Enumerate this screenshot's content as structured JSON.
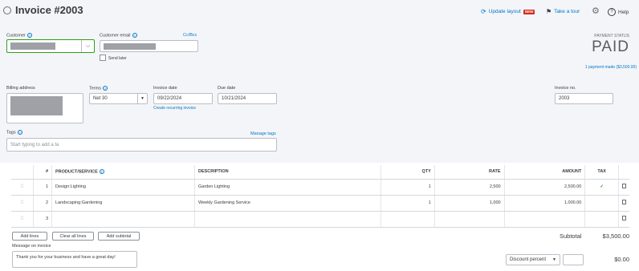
{
  "header": {
    "title": "Invoice #2003",
    "update_layout": "Update layout",
    "new_badge": "NEW",
    "take_tour": "Take a tour",
    "help": "Help"
  },
  "customer": {
    "label": "Customer",
    "email_label": "Customer email",
    "cc_bcc": "Cc/Bcc",
    "send_later": "Send later"
  },
  "payment": {
    "status_label": "PAYMENT STATUS",
    "status": "PAID",
    "payments_made": "1 payment made ($3,500.00)"
  },
  "billing": {
    "label": "Billing address"
  },
  "terms": {
    "label": "Terms",
    "value": "Net 30"
  },
  "invoice_date": {
    "label": "Invoice date",
    "value": "09/22/2024",
    "recurring": "Create recurring invoice"
  },
  "due_date": {
    "label": "Due date",
    "value": "10/21/2024"
  },
  "invoice_no": {
    "label": "Invoice no.",
    "value": "2003"
  },
  "tags": {
    "label": "Tags",
    "manage": "Manage tags",
    "placeholder": "Start typing to add a ta"
  },
  "table": {
    "headers": {
      "num": "#",
      "product": "PRODUCT/SERVICE",
      "description": "DESCRIPTION",
      "qty": "QTY",
      "rate": "RATE",
      "amount": "AMOUNT",
      "tax": "TAX"
    },
    "rows": [
      {
        "num": "1",
        "product": "Design:Lighting",
        "description": "Garden Lighting",
        "qty": "1",
        "rate": "2,500",
        "amount": "2,500.00",
        "tax": "✓"
      },
      {
        "num": "2",
        "product": "Landscaping:Gardening",
        "description": "Weekly Gardening Service",
        "qty": "1",
        "rate": "1,000",
        "amount": "1,000.00",
        "tax": ""
      },
      {
        "num": "3",
        "product": "",
        "description": "",
        "qty": "",
        "rate": "",
        "amount": "",
        "tax": ""
      }
    ]
  },
  "actions": {
    "add_lines": "Add lines",
    "clear_lines": "Clear all lines",
    "add_subtotal": "Add subtotal"
  },
  "totals": {
    "subtotal_label": "Subtotal",
    "subtotal_value": "$3,500.00",
    "discount_label": "Discount percent",
    "discount_value": "$0.00"
  },
  "message": {
    "label": "Message on invoice",
    "value": "Thank you for your business and have a great day!"
  },
  "colors": {
    "accent": "#0077c5",
    "badge": "#d52b1e",
    "check": "#2ca01c"
  }
}
